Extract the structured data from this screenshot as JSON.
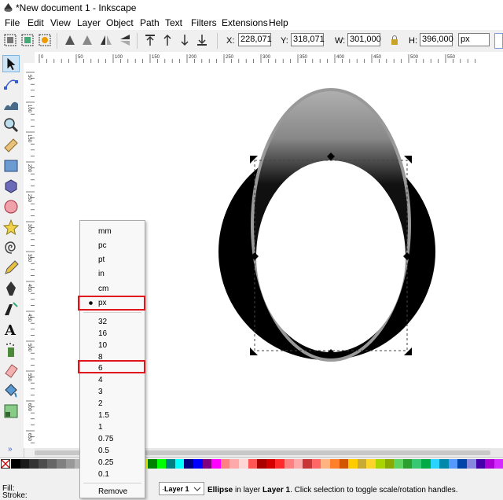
{
  "window": {
    "title": "*New document 1 - Inkscape"
  },
  "menu": [
    {
      "label": "File"
    },
    {
      "label": "Edit"
    },
    {
      "label": "View"
    },
    {
      "label": "Layer"
    },
    {
      "label": "Object"
    },
    {
      "label": "Path"
    },
    {
      "label": "Text"
    },
    {
      "label": "Filters"
    },
    {
      "label": "Extensions"
    },
    {
      "label": "Help"
    }
  ],
  "toolbar": {
    "x_label": "X:",
    "x_value": "228,071",
    "y_label": "Y:",
    "y_value": "318,071",
    "w_label": "W:",
    "w_value": "301,000",
    "h_label": "H:",
    "h_value": "396,000",
    "unit": "px"
  },
  "ruler": {
    "h_ticks": [
      "0",
      "50",
      "100",
      "150",
      "200",
      "250",
      "300",
      "350",
      "400",
      "450",
      "500",
      "550"
    ],
    "v_ticks": [
      "50",
      "100",
      "150",
      "200",
      "250",
      "300",
      "350",
      "400",
      "450",
      "500",
      "550",
      "600",
      "650"
    ]
  },
  "unit_menu": {
    "units": [
      "mm",
      "pc",
      "pt",
      "in",
      "cm",
      "px"
    ],
    "selected_unit": "px",
    "sizes": [
      "32",
      "16",
      "10",
      "8",
      "6",
      "4",
      "3",
      "2",
      "1.5",
      "1",
      "0.75",
      "0.5",
      "0.25",
      "0.1"
    ],
    "highlighted_size": "6",
    "remove_label": "Remove"
  },
  "status": {
    "fill_label": "Fill:",
    "stroke_label": "Stroke:",
    "layer_name": "Layer 1",
    "object_type": "Ellipse",
    "message_mid": " in layer ",
    "message_layer": "Layer 1",
    "message_end": ". Click selection to toggle scale/rotation handles.",
    "expander": "»"
  },
  "colors": {
    "highlight": "#e0141b",
    "palette": [
      "#000000",
      "#1a1a1a",
      "#333333",
      "#4d4d4d",
      "#666666",
      "#808080",
      "#999999",
      "#b3b3b3",
      "#cccccc",
      "#e6e6e6",
      "#ffffff",
      "#800000",
      "#ff0000",
      "#808000",
      "#ffff00",
      "#008000",
      "#00ff00",
      "#008080",
      "#00ffff",
      "#000080",
      "#0000ff",
      "#800080",
      "#ff00ff",
      "#ff8080",
      "#ffaaaa",
      "#ffd5d5",
      "#ff5555",
      "#aa0000",
      "#d40000",
      "#ff2a2a",
      "#ff8080",
      "#ffaaaa",
      "#c83737",
      "#ff6666",
      "#ffb380",
      "#ff7f2a",
      "#d45500",
      "#ffcc00",
      "#c8ab37",
      "#ffd42a",
      "#aad400",
      "#88aa00",
      "#5fd35f",
      "#2ca02c",
      "#37c871",
      "#00aa44",
      "#2ad4ff",
      "#0088aa",
      "#5599ff",
      "#0044aa",
      "#8787de",
      "#4400aa",
      "#aa00d4",
      "#d42aff"
    ]
  }
}
